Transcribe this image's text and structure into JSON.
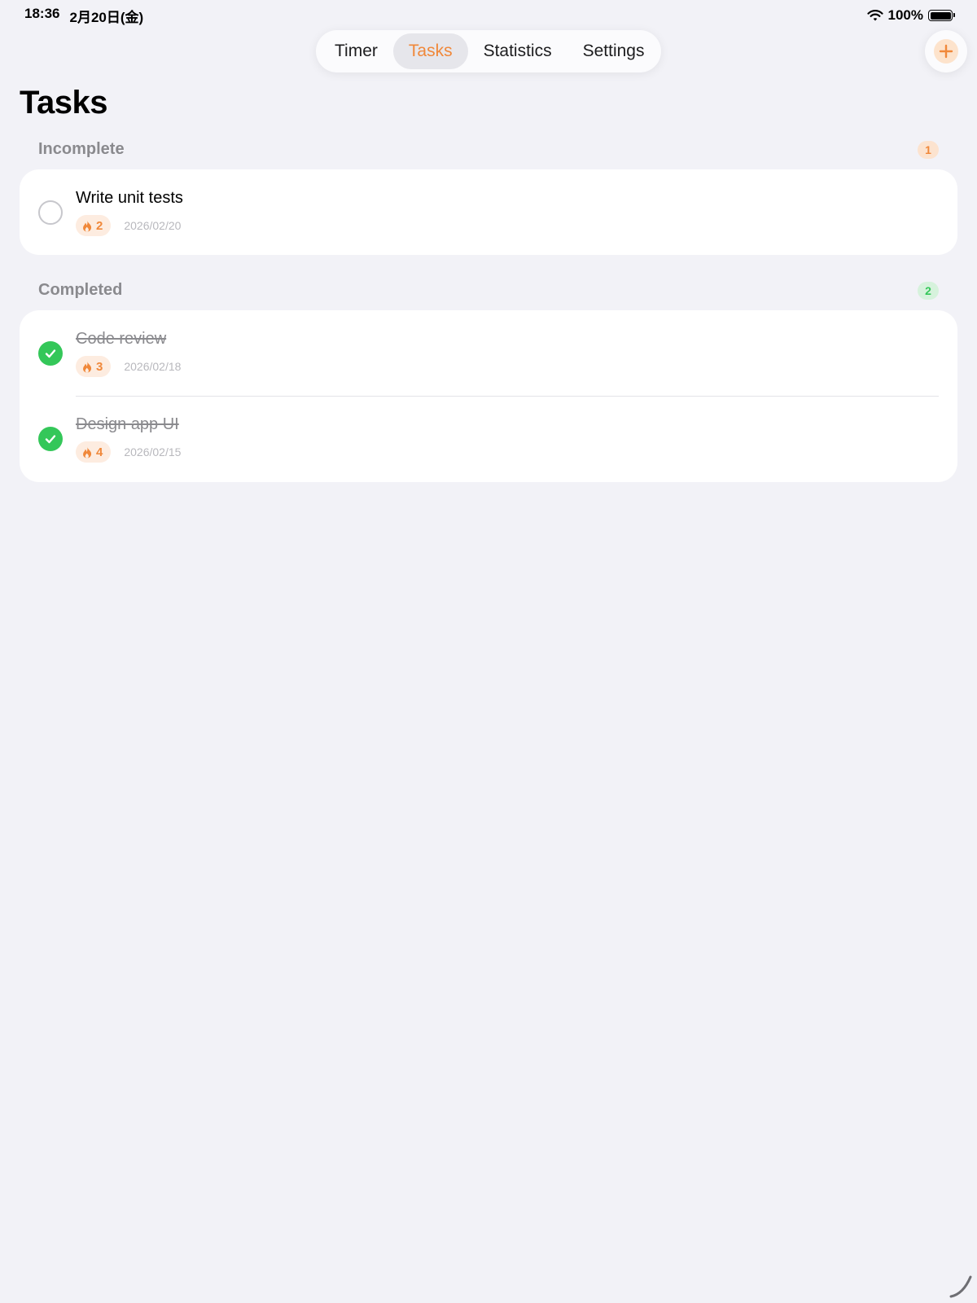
{
  "status_bar": {
    "time": "18:36",
    "date": "2月20日(金)",
    "battery": "100%"
  },
  "tabs": [
    {
      "label": "Timer",
      "active": false
    },
    {
      "label": "Tasks",
      "active": true
    },
    {
      "label": "Statistics",
      "active": false
    },
    {
      "label": "Settings",
      "active": false
    }
  ],
  "page_title": "Tasks",
  "sections": {
    "incomplete": {
      "label": "Incomplete",
      "count": "1",
      "tasks": [
        {
          "title": "Write unit tests",
          "pomodoros": "2",
          "date": "2026/02/20",
          "completed": false
        }
      ]
    },
    "completed": {
      "label": "Completed",
      "count": "2",
      "tasks": [
        {
          "title": "Code review",
          "pomodoros": "3",
          "date": "2026/02/18",
          "completed": true
        },
        {
          "title": "Design app UI",
          "pomodoros": "4",
          "date": "2026/02/15",
          "completed": true
        }
      ]
    }
  },
  "colors": {
    "accent": "#f0883a",
    "success": "#34c759",
    "background": "#f2f2f7"
  },
  "icons": {
    "wifi": "wifi-icon",
    "battery": "battery-icon",
    "add": "plus-icon",
    "pomodoro": "flame-icon",
    "check": "checkmark-icon",
    "unchecked": "empty-circle-icon"
  }
}
